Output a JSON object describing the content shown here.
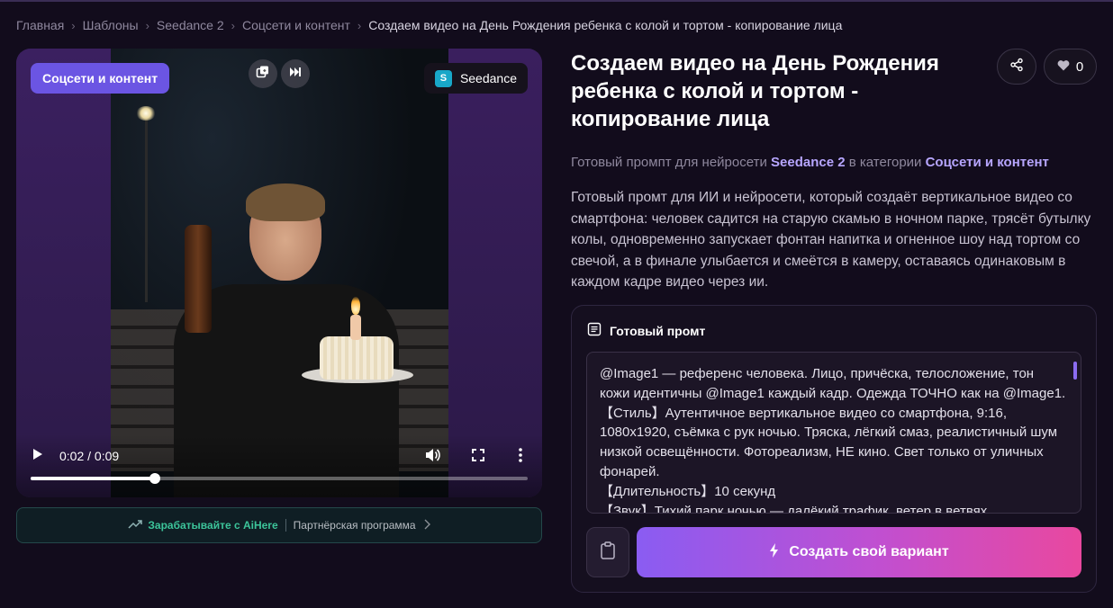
{
  "breadcrumb": {
    "items": [
      "Главная",
      "Шаблоны",
      "Seedance 2",
      "Соцсети и контент"
    ],
    "current": "Создаем видео на День Рождения ребенка с колой и тортом - копирование лица"
  },
  "video": {
    "category_badge": "Соцсети и контент",
    "model_badge": "Seedance",
    "model_logo_letter": "S",
    "time": "0:02 / 0:09",
    "progress": 0.25,
    "buffered": 1.0
  },
  "affiliate": {
    "earn_label": "Зарабатывайте с AiHere",
    "program_label": "Партнёрская программа"
  },
  "template": {
    "title": "Создаем видео на День Рождения ребенка с колой и тортом - копирование лица",
    "likes": "0",
    "subline_prefix": "Готовый промпт для нейросети",
    "subline_model": "Seedance 2",
    "subline_middle": "в категории",
    "subline_category": "Соцсети и контент",
    "description": "Готовый промт для ИИ и нейросети, который создаёт вертикальное видео со смартфона: человек садится на старую скамью в ночном парке, трясёт бутылку колы, одновременно запускает фонтан напитка и огненное шоу над тортом со свечой, а в финале улыбается и смеётся в камеру, оставаясь одинаковым в каждом кадре видео через ии."
  },
  "prompt": {
    "header": "Готовый промт",
    "lines": [
      "@Image1 — референс человека. Лицо, причёска, телосложение, тон",
      "кожи идентичны @Image1 каждый кадр. Одежда ТОЧНО как на @Image1.",
      "【Стиль】Аутентичное вертикальное видео со смартфона, 9:16,",
      "1080x1920, съёмка с рук ночью. Тряска, лёгкий смаз, реалистичный шум",
      "низкой освещённости. Фотореализм, НЕ кино. Свет только от уличных",
      "фонарей.",
      "【Длительность】10 секунд",
      "【Звук】Тихий парк ночью — далёкий трафик, ветер в ветвях."
    ],
    "create_label": "Создать свой вариант"
  },
  "colors": {
    "accent": "#6b55e3",
    "link": "#b7a6ff",
    "earn": "#3cc49a"
  },
  "icons": [
    "chevron-right-icon",
    "copy-icon",
    "skip-icon",
    "play-icon",
    "volume-icon",
    "fullscreen-icon",
    "more-vertical-icon",
    "trending-up-icon",
    "share-icon",
    "heart-icon",
    "document-icon",
    "clipboard-icon",
    "lightning-icon"
  ]
}
